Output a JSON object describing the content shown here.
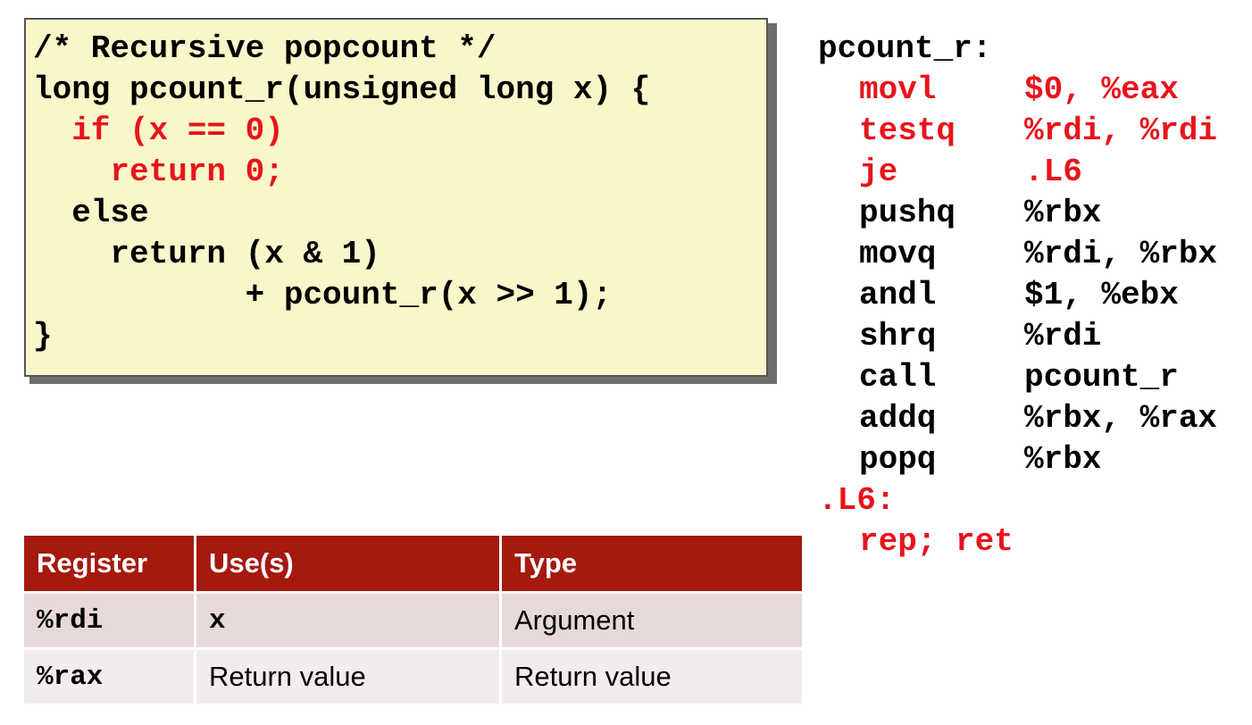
{
  "c_code": {
    "lines": [
      {
        "text": "/* Recursive popcount */",
        "highlight": false
      },
      {
        "text": "long pcount_r(unsigned long x) {",
        "highlight": false
      },
      {
        "text": "  if (x == 0)",
        "highlight": true
      },
      {
        "text": "    return 0;",
        "highlight": true
      },
      {
        "text": "  else",
        "highlight": false
      },
      {
        "text": "    return (x & 1)",
        "highlight": false
      },
      {
        "text": "           + pcount_r(x >> 1);",
        "highlight": false
      },
      {
        "text": "}",
        "highlight": false
      }
    ],
    "background_color": "#f9f7c9",
    "highlight_color": "#e8141b"
  },
  "assembly": {
    "label": "pcount_r:",
    "instructions": [
      {
        "op": "movl",
        "args": "$0, %eax",
        "highlight": true
      },
      {
        "op": "testq",
        "args": "%rdi, %rdi",
        "highlight": true
      },
      {
        "op": "je",
        "args": ".L6",
        "highlight": true
      },
      {
        "op": "pushq",
        "args": "%rbx",
        "highlight": false
      },
      {
        "op": "movq",
        "args": "%rdi, %rbx",
        "highlight": false
      },
      {
        "op": "andl",
        "args": "$1, %ebx",
        "highlight": false
      },
      {
        "op": "shrq",
        "args": "%rdi",
        "highlight": false
      },
      {
        "op": "call",
        "args": "pcount_r",
        "highlight": false
      },
      {
        "op": "addq",
        "args": "%rbx, %rax",
        "highlight": false
      },
      {
        "op": "popq",
        "args": "%rbx",
        "highlight": false
      }
    ],
    "label2": ".L6:",
    "final": "rep; ret"
  },
  "register_table": {
    "headers": [
      "Register",
      "Use(s)",
      "Type"
    ],
    "rows": [
      [
        "%rdi",
        "x",
        "Argument"
      ],
      [
        "%rax",
        "Return value",
        "Return value"
      ]
    ],
    "header_color": "#a5190f"
  }
}
